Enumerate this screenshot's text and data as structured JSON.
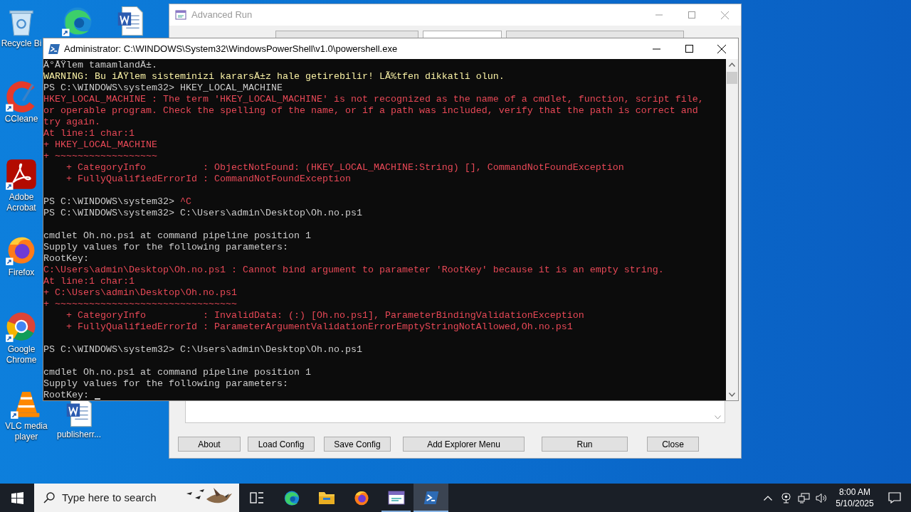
{
  "desktop_icons": [
    {
      "kind": "recycle_bin",
      "label": "Recycle Bi"
    },
    {
      "kind": "edge"
    },
    {
      "kind": "word_document"
    },
    {
      "kind": "ccleaner",
      "label": "CCleane"
    },
    {
      "kind": "acrobat",
      "label": "Adobe Acrobat"
    },
    {
      "kind": "firefox",
      "label": "Firefox"
    },
    {
      "kind": "chrome",
      "label": "Google Chrome"
    },
    {
      "kind": "vlc",
      "label": "VLC media player"
    },
    {
      "kind": "word_document",
      "label": "publisherr..."
    }
  ],
  "advanced_run": {
    "title": "Advanced Run",
    "buttons": [
      "About",
      "Load Config",
      "Save Config",
      "Add Explorer Menu",
      "Run",
      "Close"
    ]
  },
  "powershell": {
    "title": "Administrator: C:\\WINDOWS\\System32\\WindowsPowerShell\\v1.0\\powershell.exe",
    "lines": [
      {
        "segments": [
          {
            "kind": "normal",
            "text": "Ä°ÅŸlem tamamlandÄ±."
          }
        ]
      },
      {
        "segments": [
          {
            "kind": "warning",
            "text": "WARNING: Bu iÅŸlem sisteminizi kararsÄ±z hale getirebilir! LÃ%tfen dikkatli olun."
          }
        ]
      },
      {
        "segments": [
          {
            "kind": "normal",
            "text": "PS C:\\WINDOWS\\system32> HKEY_LOCAL_MACHINE"
          }
        ]
      },
      {
        "segments": [
          {
            "kind": "error",
            "text": "HKEY_LOCAL_MACHINE : The term 'HKEY_LOCAL_MACHINE' is not recognized as the name of a cmdlet, function, script file,"
          }
        ]
      },
      {
        "segments": [
          {
            "kind": "error",
            "text": "or operable program. Check the spelling of the name, or if a path was included, verify that the path is correct and"
          }
        ]
      },
      {
        "segments": [
          {
            "kind": "error",
            "text": "try again."
          }
        ]
      },
      {
        "segments": [
          {
            "kind": "error",
            "text": "At line:1 char:1"
          }
        ]
      },
      {
        "segments": [
          {
            "kind": "error",
            "text": "+ HKEY_LOCAL_MACHINE"
          }
        ]
      },
      {
        "segments": [
          {
            "kind": "error",
            "text": "+ ~~~~~~~~~~~~~~~~~~"
          }
        ]
      },
      {
        "segments": [
          {
            "kind": "error",
            "text": "    + CategoryInfo          : ObjectNotFound: (HKEY_LOCAL_MACHINE:String) [], CommandNotFoundException"
          }
        ]
      },
      {
        "segments": [
          {
            "kind": "error",
            "text": "    + FullyQualifiedErrorId : CommandNotFoundException"
          }
        ]
      },
      {
        "gap_before": true,
        "segments": [
          {
            "kind": "normal",
            "text": "PS C:\\WINDOWS\\system32> "
          },
          {
            "kind": "error",
            "text": "^C"
          }
        ]
      },
      {
        "segments": [
          {
            "kind": "normal",
            "text": "PS C:\\WINDOWS\\system32> C:\\Users\\admin\\Desktop\\Oh.no.ps1"
          }
        ]
      },
      {
        "gap_before": true,
        "segments": [
          {
            "kind": "normal",
            "text": "cmdlet Oh.no.ps1 at command pipeline position 1"
          }
        ]
      },
      {
        "segments": [
          {
            "kind": "normal",
            "text": "Supply values for the following parameters:"
          }
        ]
      },
      {
        "segments": [
          {
            "kind": "normal",
            "text": "RootKey:"
          }
        ]
      },
      {
        "segments": [
          {
            "kind": "error",
            "text": "C:\\Users\\admin\\Desktop\\Oh.no.ps1 : Cannot bind argument to parameter 'RootKey' because it is an empty string."
          }
        ]
      },
      {
        "segments": [
          {
            "kind": "error",
            "text": "At line:1 char:1"
          }
        ]
      },
      {
        "segments": [
          {
            "kind": "error",
            "text": "+ C:\\Users\\admin\\Desktop\\Oh.no.ps1"
          }
        ]
      },
      {
        "segments": [
          {
            "kind": "error",
            "text": "+ ~~~~~~~~~~~~~~~~~~~~~~~~~~~~~~~~"
          }
        ]
      },
      {
        "segments": [
          {
            "kind": "error",
            "text": "    + CategoryInfo          : InvalidData: (:) [Oh.no.ps1], ParameterBindingValidationException"
          }
        ]
      },
      {
        "segments": [
          {
            "kind": "error",
            "text": "    + FullyQualifiedErrorId : ParameterArgumentValidationErrorEmptyStringNotAllowed,Oh.no.ps1"
          }
        ]
      },
      {
        "gap_before": true,
        "segments": [
          {
            "kind": "normal",
            "text": "PS C:\\WINDOWS\\system32> C:\\Users\\admin\\Desktop\\Oh.no.ps1"
          }
        ]
      },
      {
        "gap_before": true,
        "segments": [
          {
            "kind": "normal",
            "text": "cmdlet Oh.no.ps1 at command pipeline position 1"
          }
        ]
      },
      {
        "segments": [
          {
            "kind": "normal",
            "text": "Supply values for the following parameters:"
          }
        ]
      },
      {
        "segments": [
          {
            "kind": "normal",
            "text": "RootKey: "
          }
        ],
        "cursor": true
      }
    ]
  },
  "taskbar": {
    "search_placeholder": "Type here to search",
    "apps": [
      {
        "kind": "task_view",
        "running": false,
        "selected": false
      },
      {
        "kind": "edge",
        "running": false,
        "selected": false
      },
      {
        "kind": "file_explorer",
        "running": false,
        "selected": false
      },
      {
        "kind": "firefox",
        "running": false,
        "selected": false
      },
      {
        "kind": "advanced_run",
        "running": true,
        "selected": false
      },
      {
        "kind": "powershell",
        "running": true,
        "selected": true
      }
    ],
    "time": "8:00 AM",
    "date": "5/10/2025"
  }
}
